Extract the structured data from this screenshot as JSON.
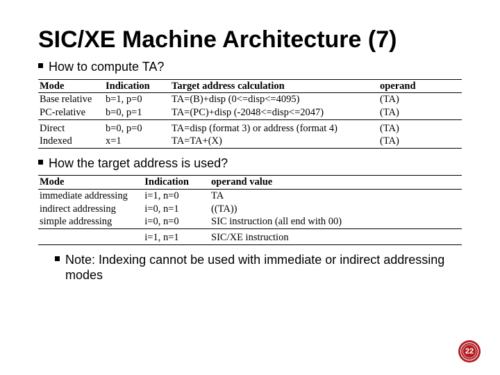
{
  "title": "SIC/XE Machine Architecture (7)",
  "bullets": {
    "b1": "How to compute TA?",
    "b2": "How the target address is used?",
    "note": "Note: Indexing cannot be used with immediate or indirect addressing modes"
  },
  "table1": {
    "head": {
      "mode": "Mode",
      "indication": "Indication",
      "calc": "Target address calculation",
      "operand": "operand"
    },
    "rows_a": [
      {
        "mode": "Base relative",
        "indication": "b=1, p=0",
        "calc": "TA=(B)+disp  (0<=disp<=4095)",
        "operand": "(TA)"
      },
      {
        "mode": "PC-relative",
        "indication": "b=0, p=1",
        "calc": "TA=(PC)+disp  (-2048<=disp<=2047)",
        "operand": "(TA)"
      }
    ],
    "rows_b": [
      {
        "mode": "Direct",
        "indication": "b=0, p=0",
        "calc": "TA=disp (format 3) or address (format 4)",
        "operand": "(TA)"
      },
      {
        "mode": "Indexed",
        "indication": "x=1",
        "calc": "TA=TA+(X)",
        "operand": "(TA)"
      }
    ]
  },
  "table2": {
    "head": {
      "mode": "Mode",
      "indication": "Indication",
      "operand": "operand value"
    },
    "rows_a": [
      {
        "mode": "immediate addressing",
        "indication": "i=1, n=0",
        "operand": "TA"
      },
      {
        "mode": "indirect addressing",
        "indication": "i=0, n=1",
        "operand": "((TA))"
      },
      {
        "mode": "simple addressing",
        "indication": "i=0, n=0",
        "operand": "SIC instruction (all end with 00)"
      }
    ],
    "rows_b": [
      {
        "mode": "",
        "indication": "i=1, n=1",
        "operand": "SIC/XE instruction"
      }
    ]
  },
  "page_number": "22"
}
